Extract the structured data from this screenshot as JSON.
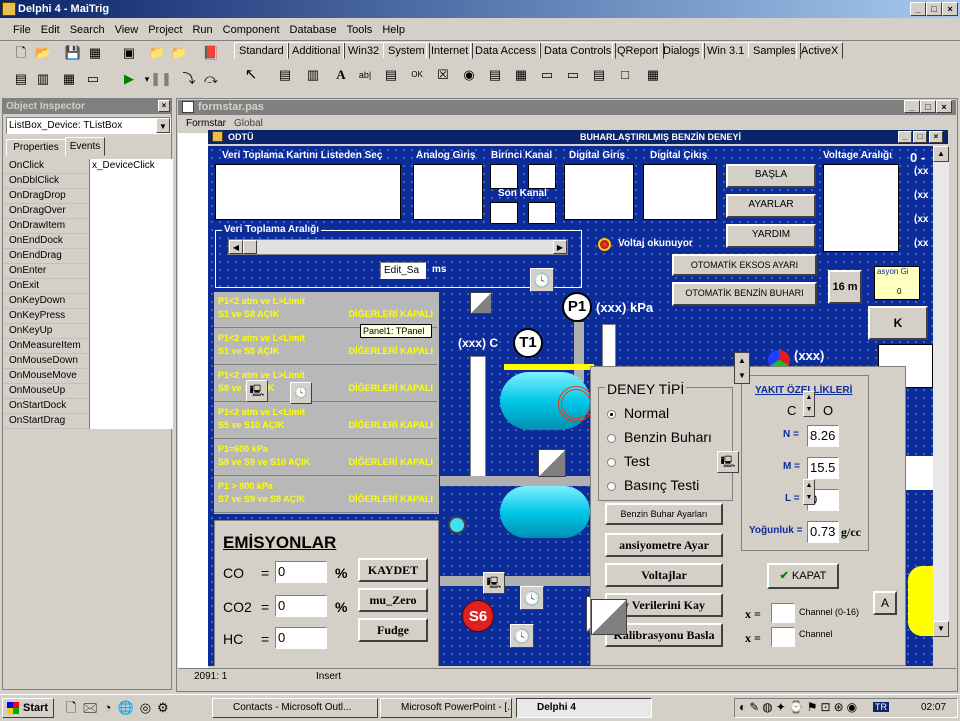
{
  "app": {
    "title": "Delphi 4 - MaiTrig"
  },
  "menu": [
    "File",
    "Edit",
    "Search",
    "View",
    "Project",
    "Run",
    "Component",
    "Database",
    "Tools",
    "Help"
  ],
  "palette_tabs": [
    "Standard",
    "Additional",
    "Win32",
    "System",
    "Internet",
    "Data Access",
    "Data Controls",
    "QReport",
    "Dialogs",
    "Win 3.1",
    "Samples",
    "ActiveX"
  ],
  "inspector": {
    "title": "Object Inspector",
    "selected": "ListBox_Device: TListBox",
    "tabs": [
      "Properties",
      "Events"
    ],
    "onclick_value": "x_DeviceClick",
    "events": [
      "OnClick",
      "OnDblClick",
      "OnDragDrop",
      "OnDragOver",
      "OnDrawItem",
      "OnEndDock",
      "OnEndDrag",
      "OnEnter",
      "OnExit",
      "OnKeyDown",
      "OnKeyPress",
      "OnKeyUp",
      "OnMeasureItem",
      "OnMouseDown",
      "OnMouseMove",
      "OnMouseUp",
      "OnStartDock",
      "OnStartDrag"
    ]
  },
  "editor": {
    "title": "formstar.pas",
    "tabs": [
      "Formstar",
      "Global"
    ],
    "status_pos": "2091: 1",
    "status_mode": "Insert"
  },
  "form": {
    "left_title": "ODTÜ",
    "title": "BUHARLAŞTIRILMIŞ BENZİN DENEYİ",
    "labels": {
      "device_list": "Veri Toplama Kartını Listeden Seç",
      "analog": "Analog Giriş",
      "first_channel": "Birinci Kanal",
      "last_channel": "Son Kanal",
      "digital_in": "Digital Giriş",
      "digital_out": "Digital Çıkış",
      "voltage_range": "Voltage Aralığı",
      "range_group": "Veri Toplama Aralığı",
      "ms": "ms",
      "voltage_reading": "Voltaj okunuyor",
      "p1": "P1",
      "pressure": "(xxx) kPa",
      "t1": "T1",
      "t1_value": "(xxx) C",
      "s6": "S6",
      "xxx": "(xxx)",
      "sixteen": "16 m",
      "big_zero": "0 -",
      "kapa": "K"
    },
    "edit_text": "Edit_Sa",
    "panel_hint": "Panel1: TPanel",
    "buttons": {
      "start": "BAŞLA",
      "settings": "AYARLAR",
      "help": "YARDIM",
      "exhaust": "OTOMATİK EKSOS AYARI",
      "fuel_vapor": "OTOMATİK BENZİN BUHARI"
    },
    "conditions": [
      {
        "l1": "P1<2 atm ve L>Limit",
        "l2": "S1 ve S8 AÇIK",
        "r": "DİĞERLERİ KAPALI"
      },
      {
        "l1": "P1<2 atm ve L<Limit",
        "l2": "S1 ve S5 AÇIK",
        "r": "DİĞERLERİ KAPALI"
      },
      {
        "l1": "P1<2 atm ve L>Limit",
        "l2": "S8 ve S AÇIK",
        "r": "DİĞERLERİ KAPALI"
      },
      {
        "l1": "P1<2 atm ve L<Limit",
        "l2": "S5 ve S10 AÇIK",
        "r": "DİĞERLERİ KAPALI"
      },
      {
        "l1": "P1=600 kPa",
        "l2": "S8 ve S9 ve S10 AÇIK",
        "r": "DİĞERLERİ KAPALI"
      },
      {
        "l1": "P1 > 800 kPa",
        "l2": "S7 ve S9 ve S8 AÇIK",
        "r": "DİĞERLERİ KAPALI"
      }
    ],
    "emissions": {
      "title": "EMİSYONLAR",
      "rows": [
        {
          "gas": "CO",
          "value": "0",
          "unit": "%"
        },
        {
          "gas": "CO2",
          "value": "0",
          "unit": "%"
        },
        {
          "gas": "HC",
          "value": "0",
          "unit": ""
        }
      ],
      "buttons": [
        "KAYDET",
        "mu_Zero",
        "Fudge"
      ]
    },
    "test_type": {
      "title": "DENEY TİPİ",
      "options": [
        "Normal",
        "Benzin Buharı",
        "Test",
        "Basınç Testi"
      ],
      "selected": 0
    },
    "mid_buttons": [
      "Benzin Buhar Ayarları",
      "ansiyometre Ayar",
      "Voltajlar",
      "y Verilerini Kay",
      "Kalibrasyonu Basla"
    ],
    "fuel": {
      "title": "YAKIT ÖZELLİKLERİ",
      "c": "C",
      "o": "O",
      "n_label": "N =",
      "n_value": "8.26",
      "m_label": "M =",
      "m_value": "15.5",
      "l_label": "L =",
      "l_value": "0",
      "density_label": "Yoğunluk =",
      "density_value": "0.73",
      "density_unit": "g/cc"
    },
    "close_btn": "KAPAT",
    "a_btn": "A",
    "channel": {
      "x1": "x =",
      "label1": "Channel (0-16)",
      "x2": "x =",
      "label2": "Channel"
    },
    "xx_list": [
      "(xx",
      "(xx",
      "(xx",
      "(xx"
    ],
    "calib": "asyon Gi",
    "gauge_value": "0"
  },
  "taskbar": {
    "start": "Start",
    "tasks": [
      "Contacts - Microsoft Outl...",
      "Microsoft PowerPoint - [...",
      "Delphi 4"
    ],
    "clock": "02:07",
    "lang": "TR"
  }
}
